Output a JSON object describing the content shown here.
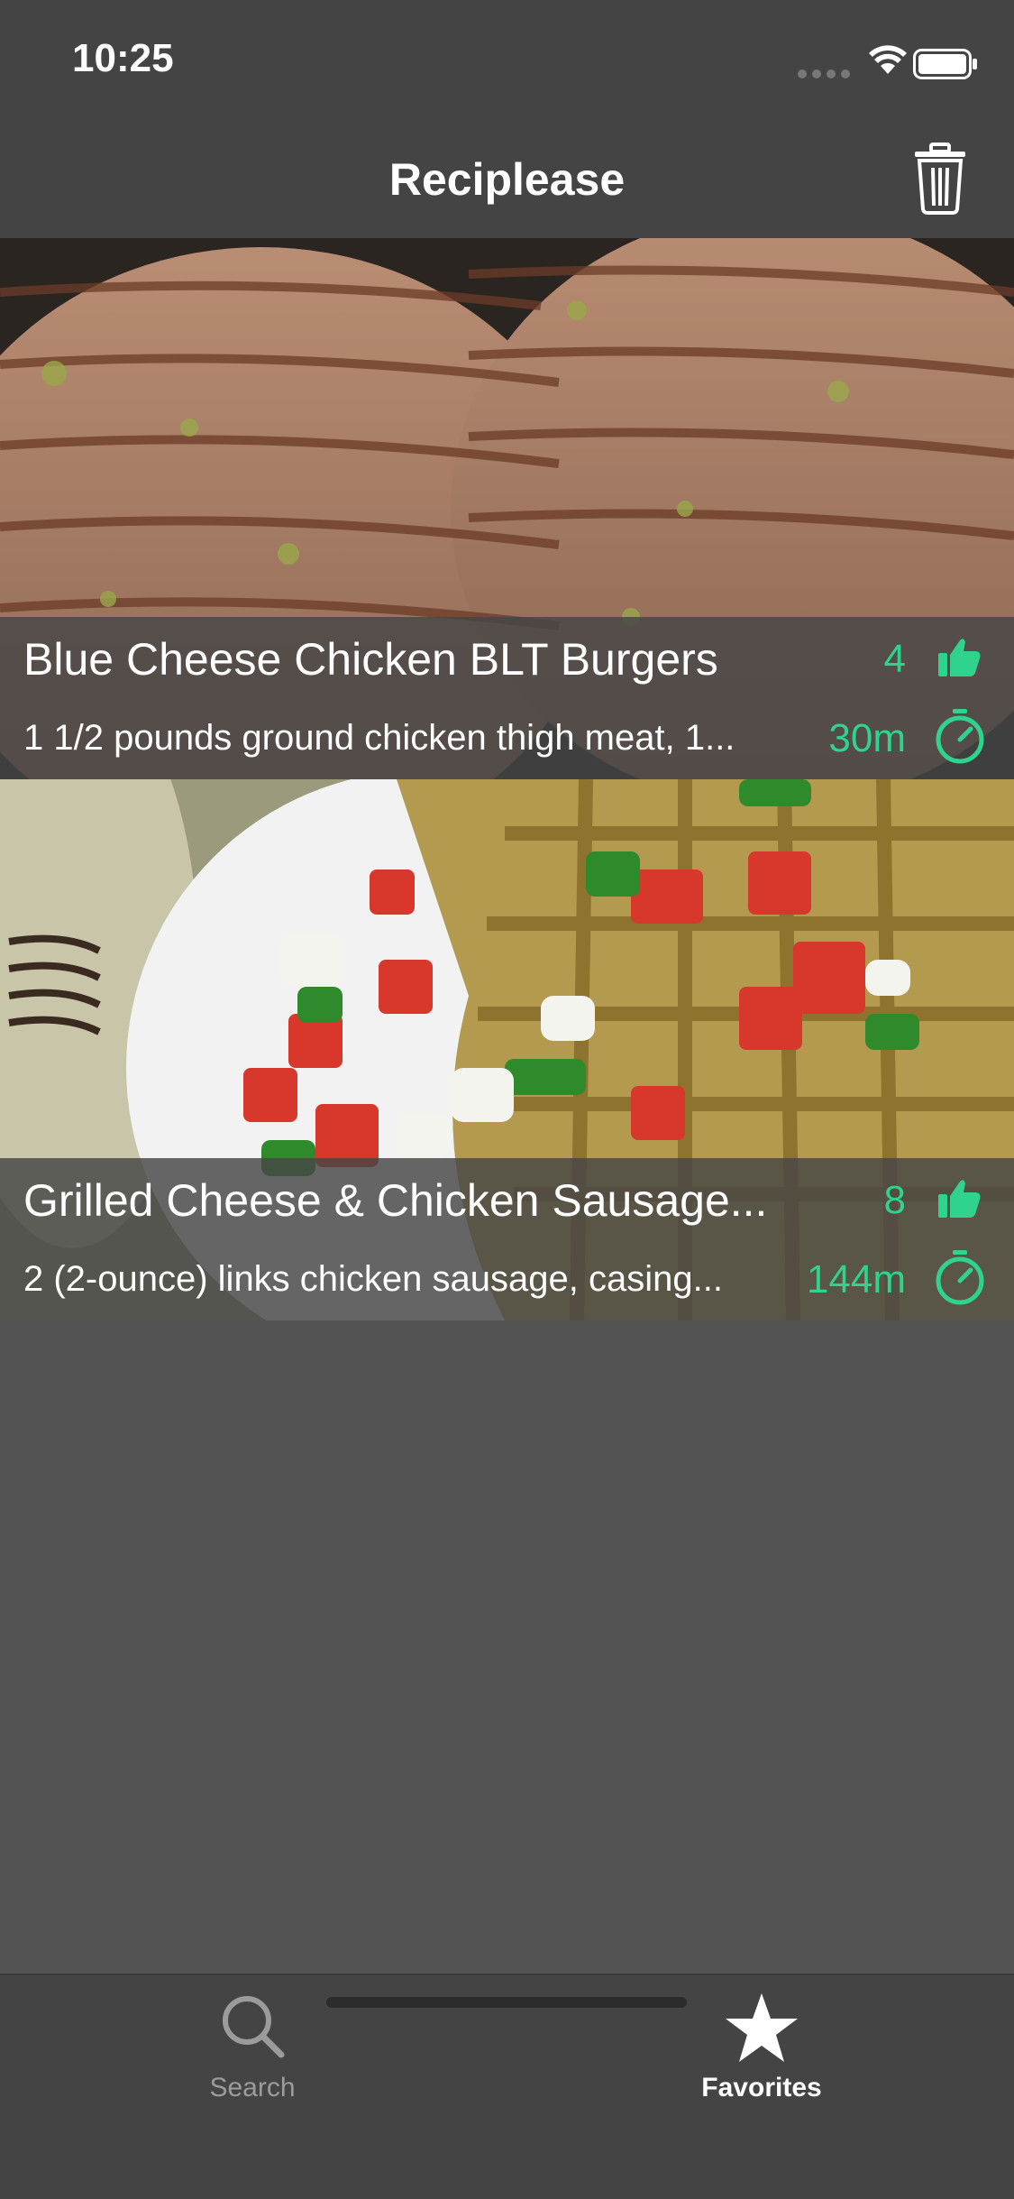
{
  "status_bar": {
    "time": "10:25"
  },
  "nav": {
    "title": "Reciplease",
    "trash_icon": "trash-icon"
  },
  "recipes": [
    {
      "title": "Blue Cheese Chicken BLT Burgers",
      "ingredients": "1 1/2 pounds ground chicken thigh meat, 1...",
      "likes": "4",
      "time": "30m",
      "image": "grilled chicken burger patties"
    },
    {
      "title": "Grilled Cheese & Chicken Sausage...",
      "ingredients": "2 (2-ounce) links chicken sausage,  casing...",
      "likes": "8",
      "time": "144m",
      "image": "waffle with tomato salsa on plate"
    }
  ],
  "tabbar": {
    "tabs": [
      {
        "label": "Search",
        "icon": "search-icon",
        "selected": false
      },
      {
        "label": "Favorites",
        "icon": "star-icon",
        "selected": true
      }
    ]
  },
  "colors": {
    "accent": "#2fd38d",
    "bar": "#444444",
    "background": "#535353"
  }
}
